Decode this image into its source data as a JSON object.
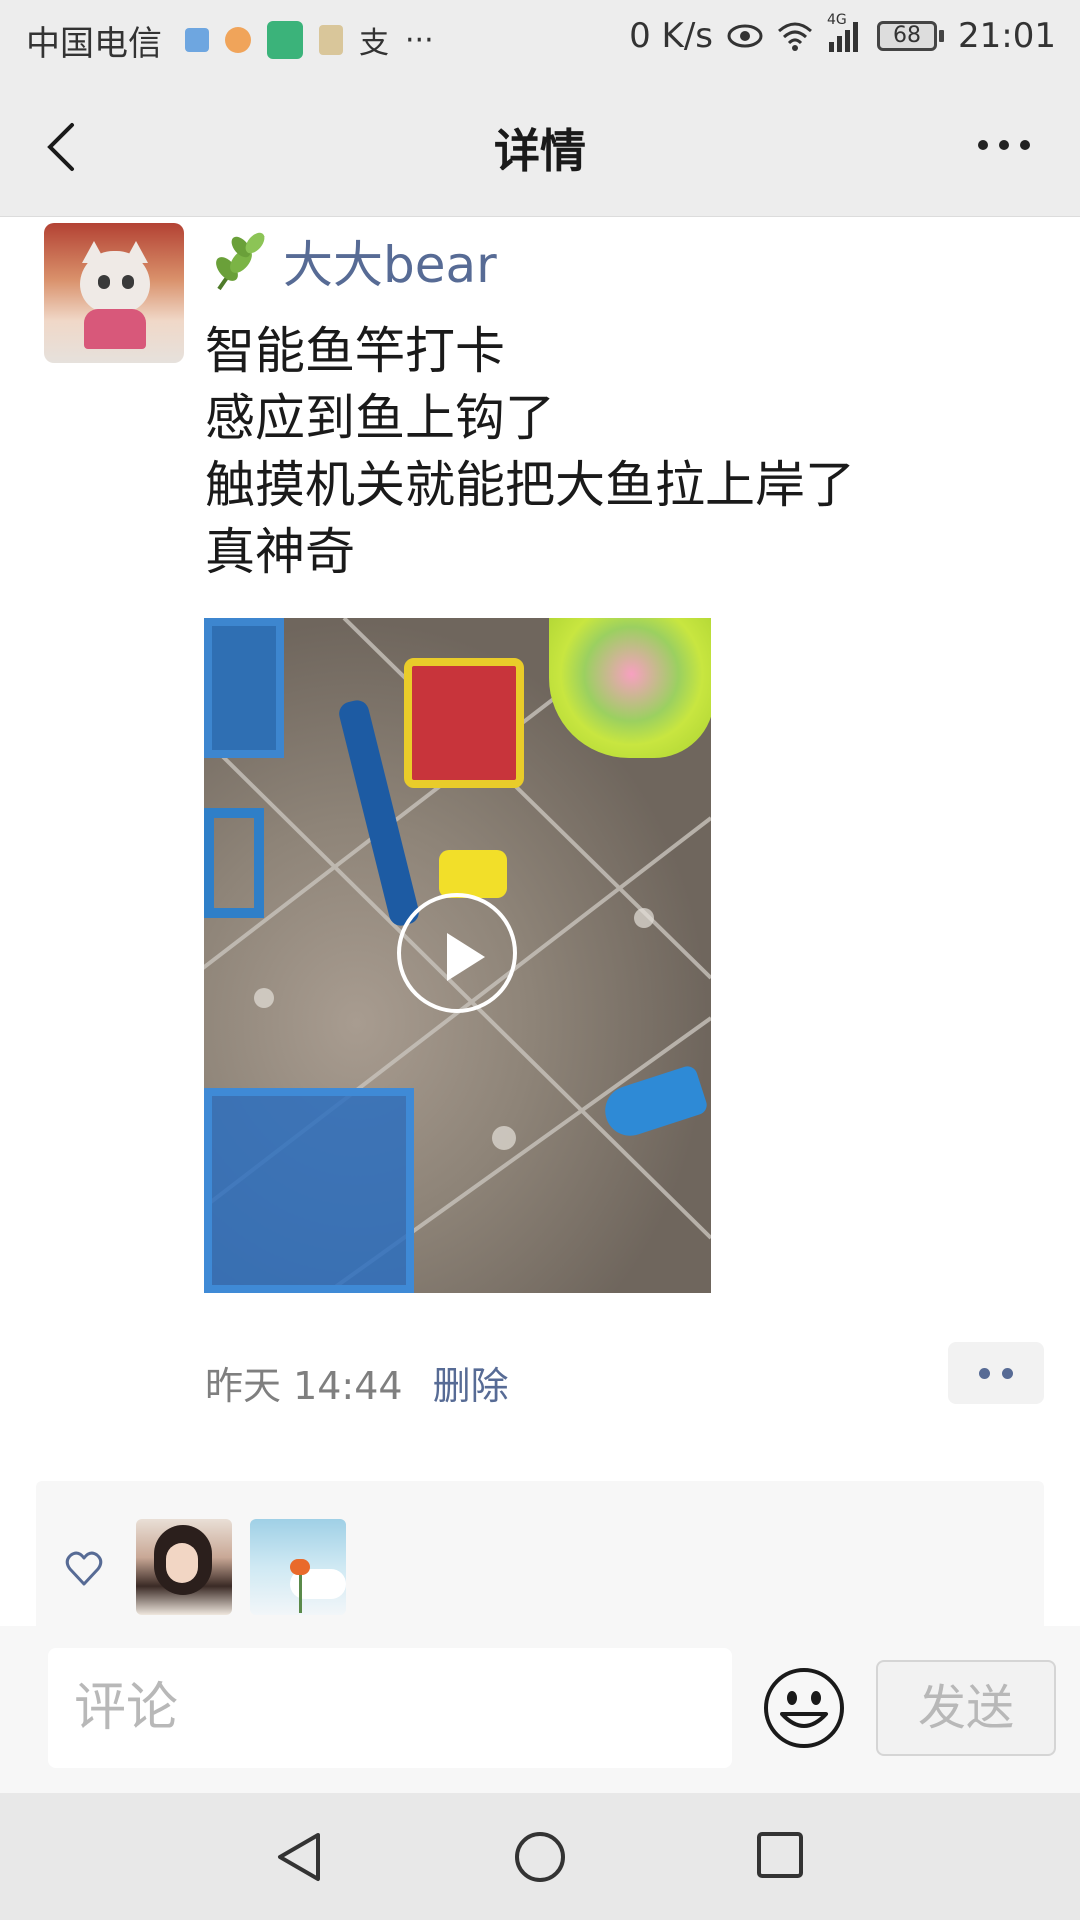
{
  "status_bar": {
    "carrier": "中国电信",
    "notification_icons": [
      "video-icon",
      "app-icon",
      "calendar-icon",
      "bag-icon",
      "alipay-icon"
    ],
    "alipay_glyph": "支",
    "more_indicator": "···",
    "net_speed": "0 K/s",
    "network_type": "4G",
    "battery": "68",
    "time": "21:01"
  },
  "header": {
    "title": "详情",
    "back_icon": "chevron-left-icon",
    "more_icon": "more-dots-icon"
  },
  "post": {
    "username": "大大bear",
    "username_icon": "leaf-icon",
    "text_lines": [
      "智能鱼竿打卡",
      "感应到鱼上钩了",
      "触摸机关就能把大鱼拉上岸了",
      "真神奇"
    ],
    "media": {
      "type": "video",
      "play_icon": "play-icon"
    },
    "time": "昨天 14:44",
    "delete_label": "删除"
  },
  "likes": {
    "icon": "heart-icon",
    "likers": [
      "liker-avatar-1",
      "liker-avatar-2"
    ]
  },
  "comment_bar": {
    "placeholder": "评论",
    "emoji_icon": "emoji-icon",
    "send_label": "发送"
  },
  "colors": {
    "link": "#576b95",
    "header_bg": "#ededed",
    "meta_gray": "#7f7f7f"
  }
}
